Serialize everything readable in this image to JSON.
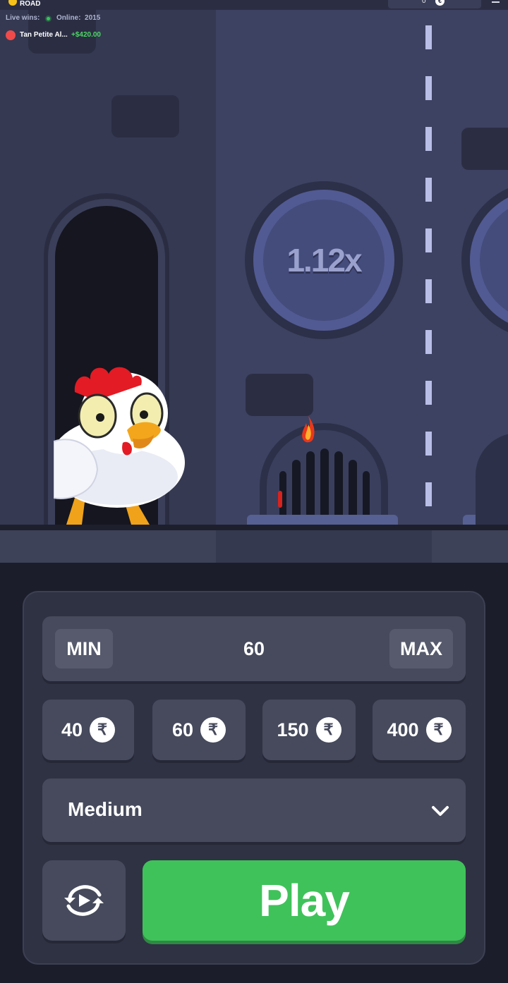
{
  "header": {
    "logo_text": "ROAD",
    "balance": "0",
    "balance_currency_icon": "coin-icon"
  },
  "live": {
    "live_wins_label": "Live wins:",
    "online_label": "Online:",
    "online_count": "2015",
    "latest_win": {
      "name": "Tan Petite Al...",
      "amount": "+$420.00"
    }
  },
  "game": {
    "multiplier": "1.12x",
    "character": "chicken"
  },
  "controls": {
    "min_label": "MIN",
    "max_label": "MAX",
    "bet_value": "60",
    "chips": [
      {
        "value": "40",
        "currency": "₹"
      },
      {
        "value": "60",
        "currency": "₹"
      },
      {
        "value": "150",
        "currency": "₹"
      },
      {
        "value": "400",
        "currency": "₹"
      }
    ],
    "difficulty": "Medium",
    "play_label": "Play"
  },
  "colors": {
    "play": "#3fc25a",
    "panel": "#2f3243",
    "win_amount": "#4cd964"
  }
}
